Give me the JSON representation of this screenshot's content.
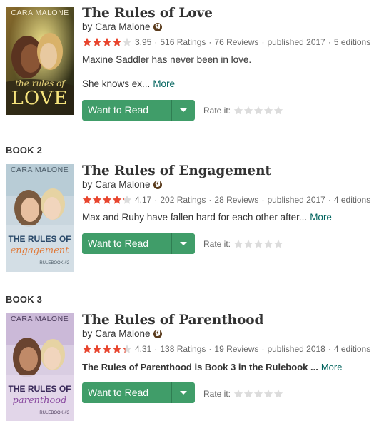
{
  "colors": {
    "star_filled": "#e8452e",
    "star_empty": "#dcdcdc",
    "button_green": "#409d69",
    "link_teal": "#00635d",
    "text": "#333333",
    "muted": "#666666"
  },
  "books": [
    {
      "series_label": "",
      "cover": {
        "author_text": "CARA MALONE",
        "title_line1": "the rules of",
        "title_line2": "LOVE",
        "icon": "book-cover-image"
      },
      "title": "The Rules of Love",
      "by": "by",
      "author": "Cara Malone",
      "rating": 3.95,
      "rating_text": "3.95",
      "ratings_count": "516 Ratings",
      "reviews_count": "76 Reviews",
      "published": "published 2017",
      "editions": "5 editions",
      "description_line1": "Maxine Saddler has never been in love.",
      "description_line2": "She knows ex...",
      "more": "More",
      "want_to_read": "Want to Read",
      "rate_it": "Rate it:"
    },
    {
      "series_label": "BOOK 2",
      "cover": {
        "author_text": "CARA MALONE",
        "title_line1": "THE RULES OF",
        "title_line2": "engagement",
        "series_text": "RULEBOOK #2",
        "icon": "book-cover-image"
      },
      "title": "The Rules of Engagement",
      "by": "by",
      "author": "Cara Malone",
      "rating": 4.17,
      "rating_text": "4.17",
      "ratings_count": "202 Ratings",
      "reviews_count": "28 Reviews",
      "published": "published 2017",
      "editions": "4 editions",
      "description_line1": "Max and Ruby have fallen hard for each other after...",
      "more": "More",
      "want_to_read": "Want to Read",
      "rate_it": "Rate it:"
    },
    {
      "series_label": "BOOK 3",
      "cover": {
        "author_text": "CARA MALONE",
        "title_line1": "THE RULES OF",
        "title_line2": "parenthood",
        "series_text": "RULEBOOK #3",
        "icon": "book-cover-image"
      },
      "title": "The Rules of Parenthood",
      "by": "by",
      "author": "Cara Malone",
      "rating": 4.31,
      "rating_text": "4.31",
      "ratings_count": "138 Ratings",
      "reviews_count": "19 Reviews",
      "published": "published 2018",
      "editions": "4 editions",
      "description_line1": "The Rules of Parenthood is Book 3 in the Rulebook ...",
      "more": "More",
      "want_to_read": "Want to Read",
      "rate_it": "Rate it:"
    }
  ]
}
